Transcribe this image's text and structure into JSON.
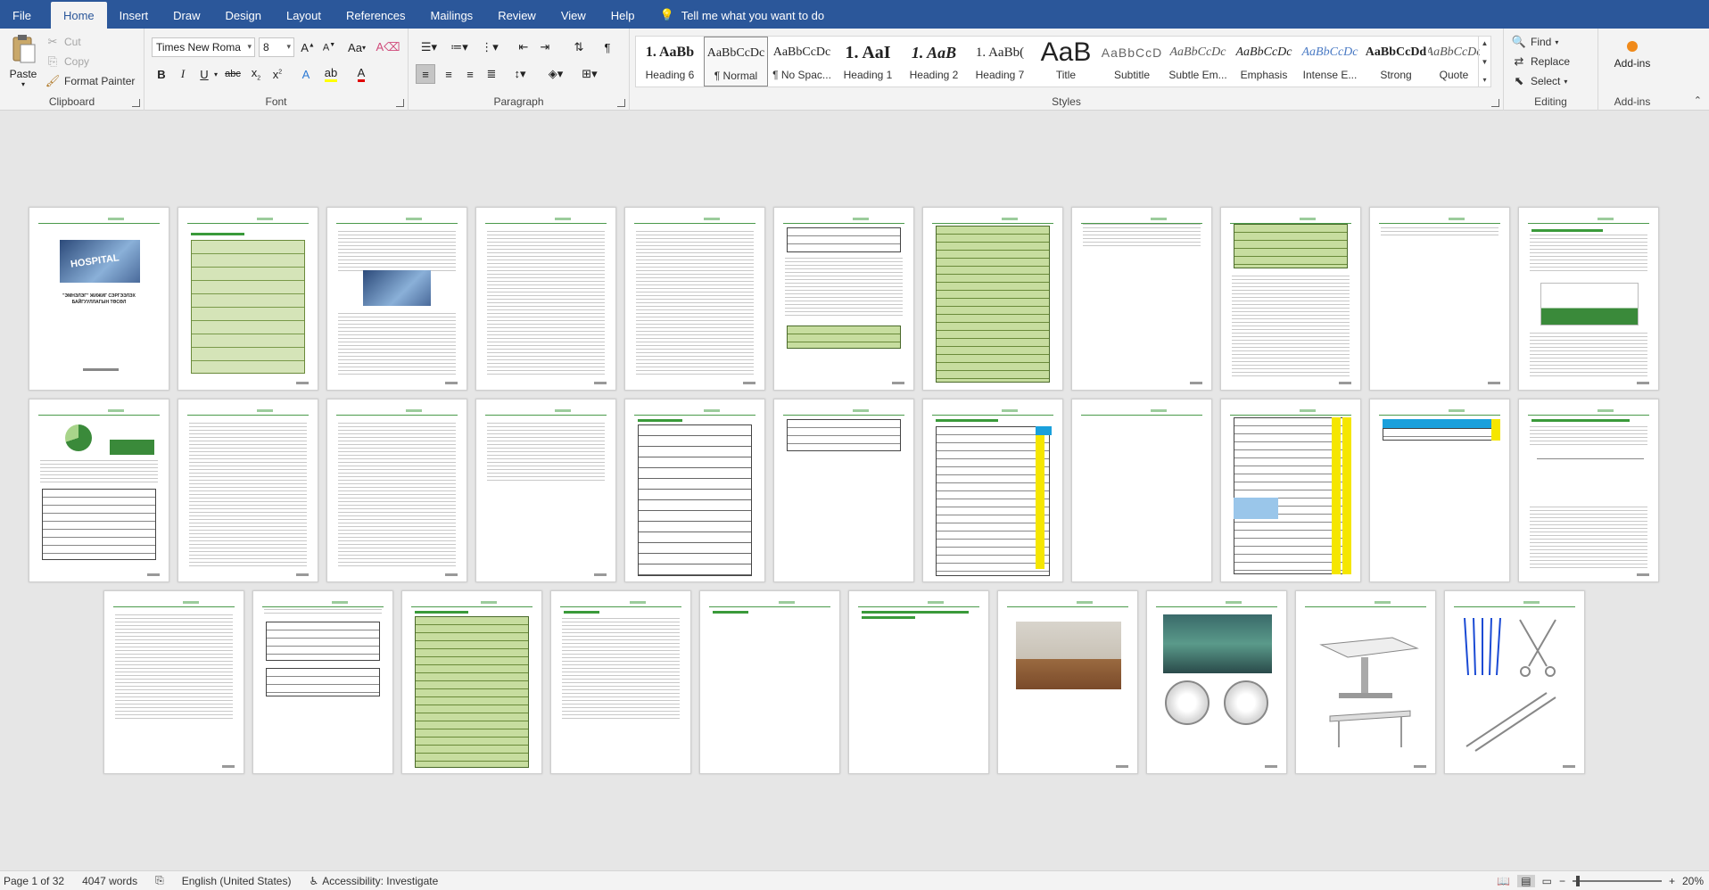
{
  "tabs": [
    "File",
    "Home",
    "Insert",
    "Draw",
    "Design",
    "Layout",
    "References",
    "Mailings",
    "Review",
    "View",
    "Help"
  ],
  "active_tab": "Home",
  "tellme": "Tell me what you want to do",
  "clipboard": {
    "paste": "Paste",
    "cut": "Cut",
    "copy": "Copy",
    "format_painter": "Format Painter",
    "label": "Clipboard"
  },
  "font": {
    "name": "Times New Roma",
    "size": "8",
    "label": "Font",
    "case_label": "Aa"
  },
  "paragraph": {
    "label": "Paragraph"
  },
  "styles": {
    "label": "Styles",
    "items": [
      {
        "preview": "1. AaBb",
        "name": "Heading 6"
      },
      {
        "preview": "AaBbCcDc",
        "name": "¶ Normal"
      },
      {
        "preview": "AaBbCcDc",
        "name": "¶ No Spac..."
      },
      {
        "preview": "1. AaI",
        "name": "Heading 1"
      },
      {
        "preview": "1. AaB",
        "name": "Heading 2"
      },
      {
        "preview": "1. AaBb(",
        "name": "Heading 7"
      },
      {
        "preview": "AaB",
        "name": "Title"
      },
      {
        "preview": "AaBbCcD",
        "name": "Subtitle"
      },
      {
        "preview": "AaBbCcDc",
        "name": "Subtle Em..."
      },
      {
        "preview": "AaBbCcDc",
        "name": "Emphasis"
      },
      {
        "preview": "AaBbCcDc",
        "name": "Intense E..."
      },
      {
        "preview": "AaBbCcDd",
        "name": "Strong"
      },
      {
        "preview": "AaBbCcDc",
        "name": "Quote"
      }
    ]
  },
  "editing": {
    "find": "Find",
    "replace": "Replace",
    "select": "Select",
    "label": "Editing"
  },
  "addins": {
    "button": "Add-ins",
    "label": "Add-ins"
  },
  "pages": {
    "cover_title": "\"ЭМНЭЛЭГ\" ЖИЖИГ СЭРГЭЭЛЭХ БАЙГУУЛЛАГЫН ТӨСӨЛ",
    "hospital_sign": "HOSPITAL"
  },
  "status": {
    "page": "Page 1 of 32",
    "words": "4047 words",
    "language": "English (United States)",
    "accessibility": "Accessibility: Investigate",
    "zoom": "20%"
  },
  "colors": {
    "ribbon_blue": "#2b579a",
    "accent_green": "#3a9a3a",
    "highlight_yellow": "#f5e600"
  }
}
